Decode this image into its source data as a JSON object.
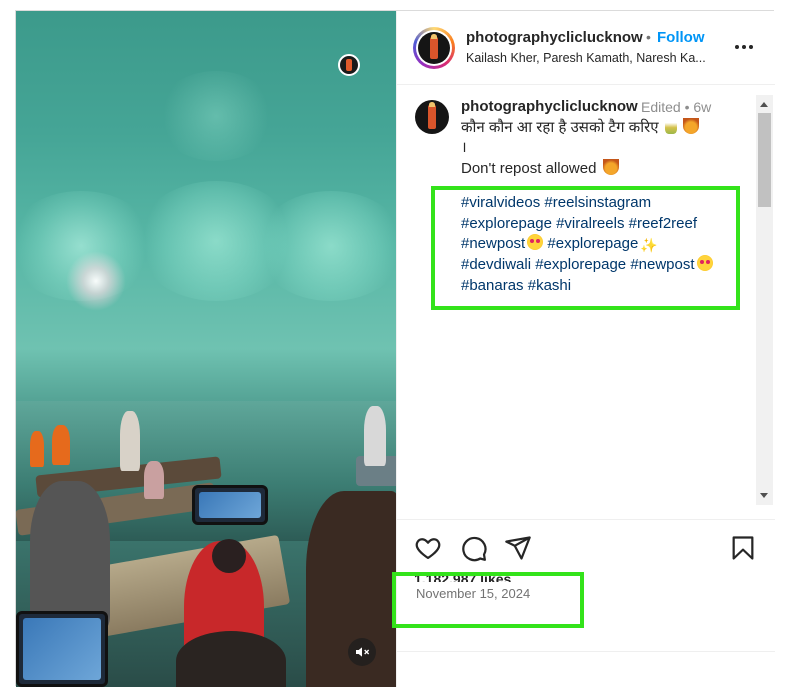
{
  "post": {
    "username": "photographycliclucknow",
    "follow_label": "Follow",
    "separator": "•",
    "audio_line": "Kailash Kher, Paresh Kamath, Naresh Ka..."
  },
  "caption": {
    "username": "photographycliclucknow",
    "meta": "Edited • 6w",
    "line1": "कौन कौन आ रहा है उसको टैग करिए",
    "line2": "।",
    "line3": "Don't repost allowed",
    "line4": ".",
    "tags": [
      [
        "#viralvideos",
        "#reelsinstagram"
      ],
      [
        "#explorepage",
        "#viralreels",
        "#reef2reef"
      ],
      [
        "#newpost",
        "#explorepage"
      ],
      [
        "#devdiwali",
        "#explorepage",
        "#newpost"
      ],
      [
        "#banaras",
        "#kashi"
      ]
    ]
  },
  "stats": {
    "likes": "1,182,987 likes",
    "date": "November 15, 2024"
  },
  "icons": {
    "like": "heart-icon",
    "comment": "comment-icon",
    "share": "share-icon",
    "save": "bookmark-icon",
    "more": "more-icon",
    "mute": "muted-speaker-icon"
  },
  "colors": {
    "follow": "#0095f6",
    "hashtag": "#00376b",
    "highlight": "#33e31a"
  }
}
